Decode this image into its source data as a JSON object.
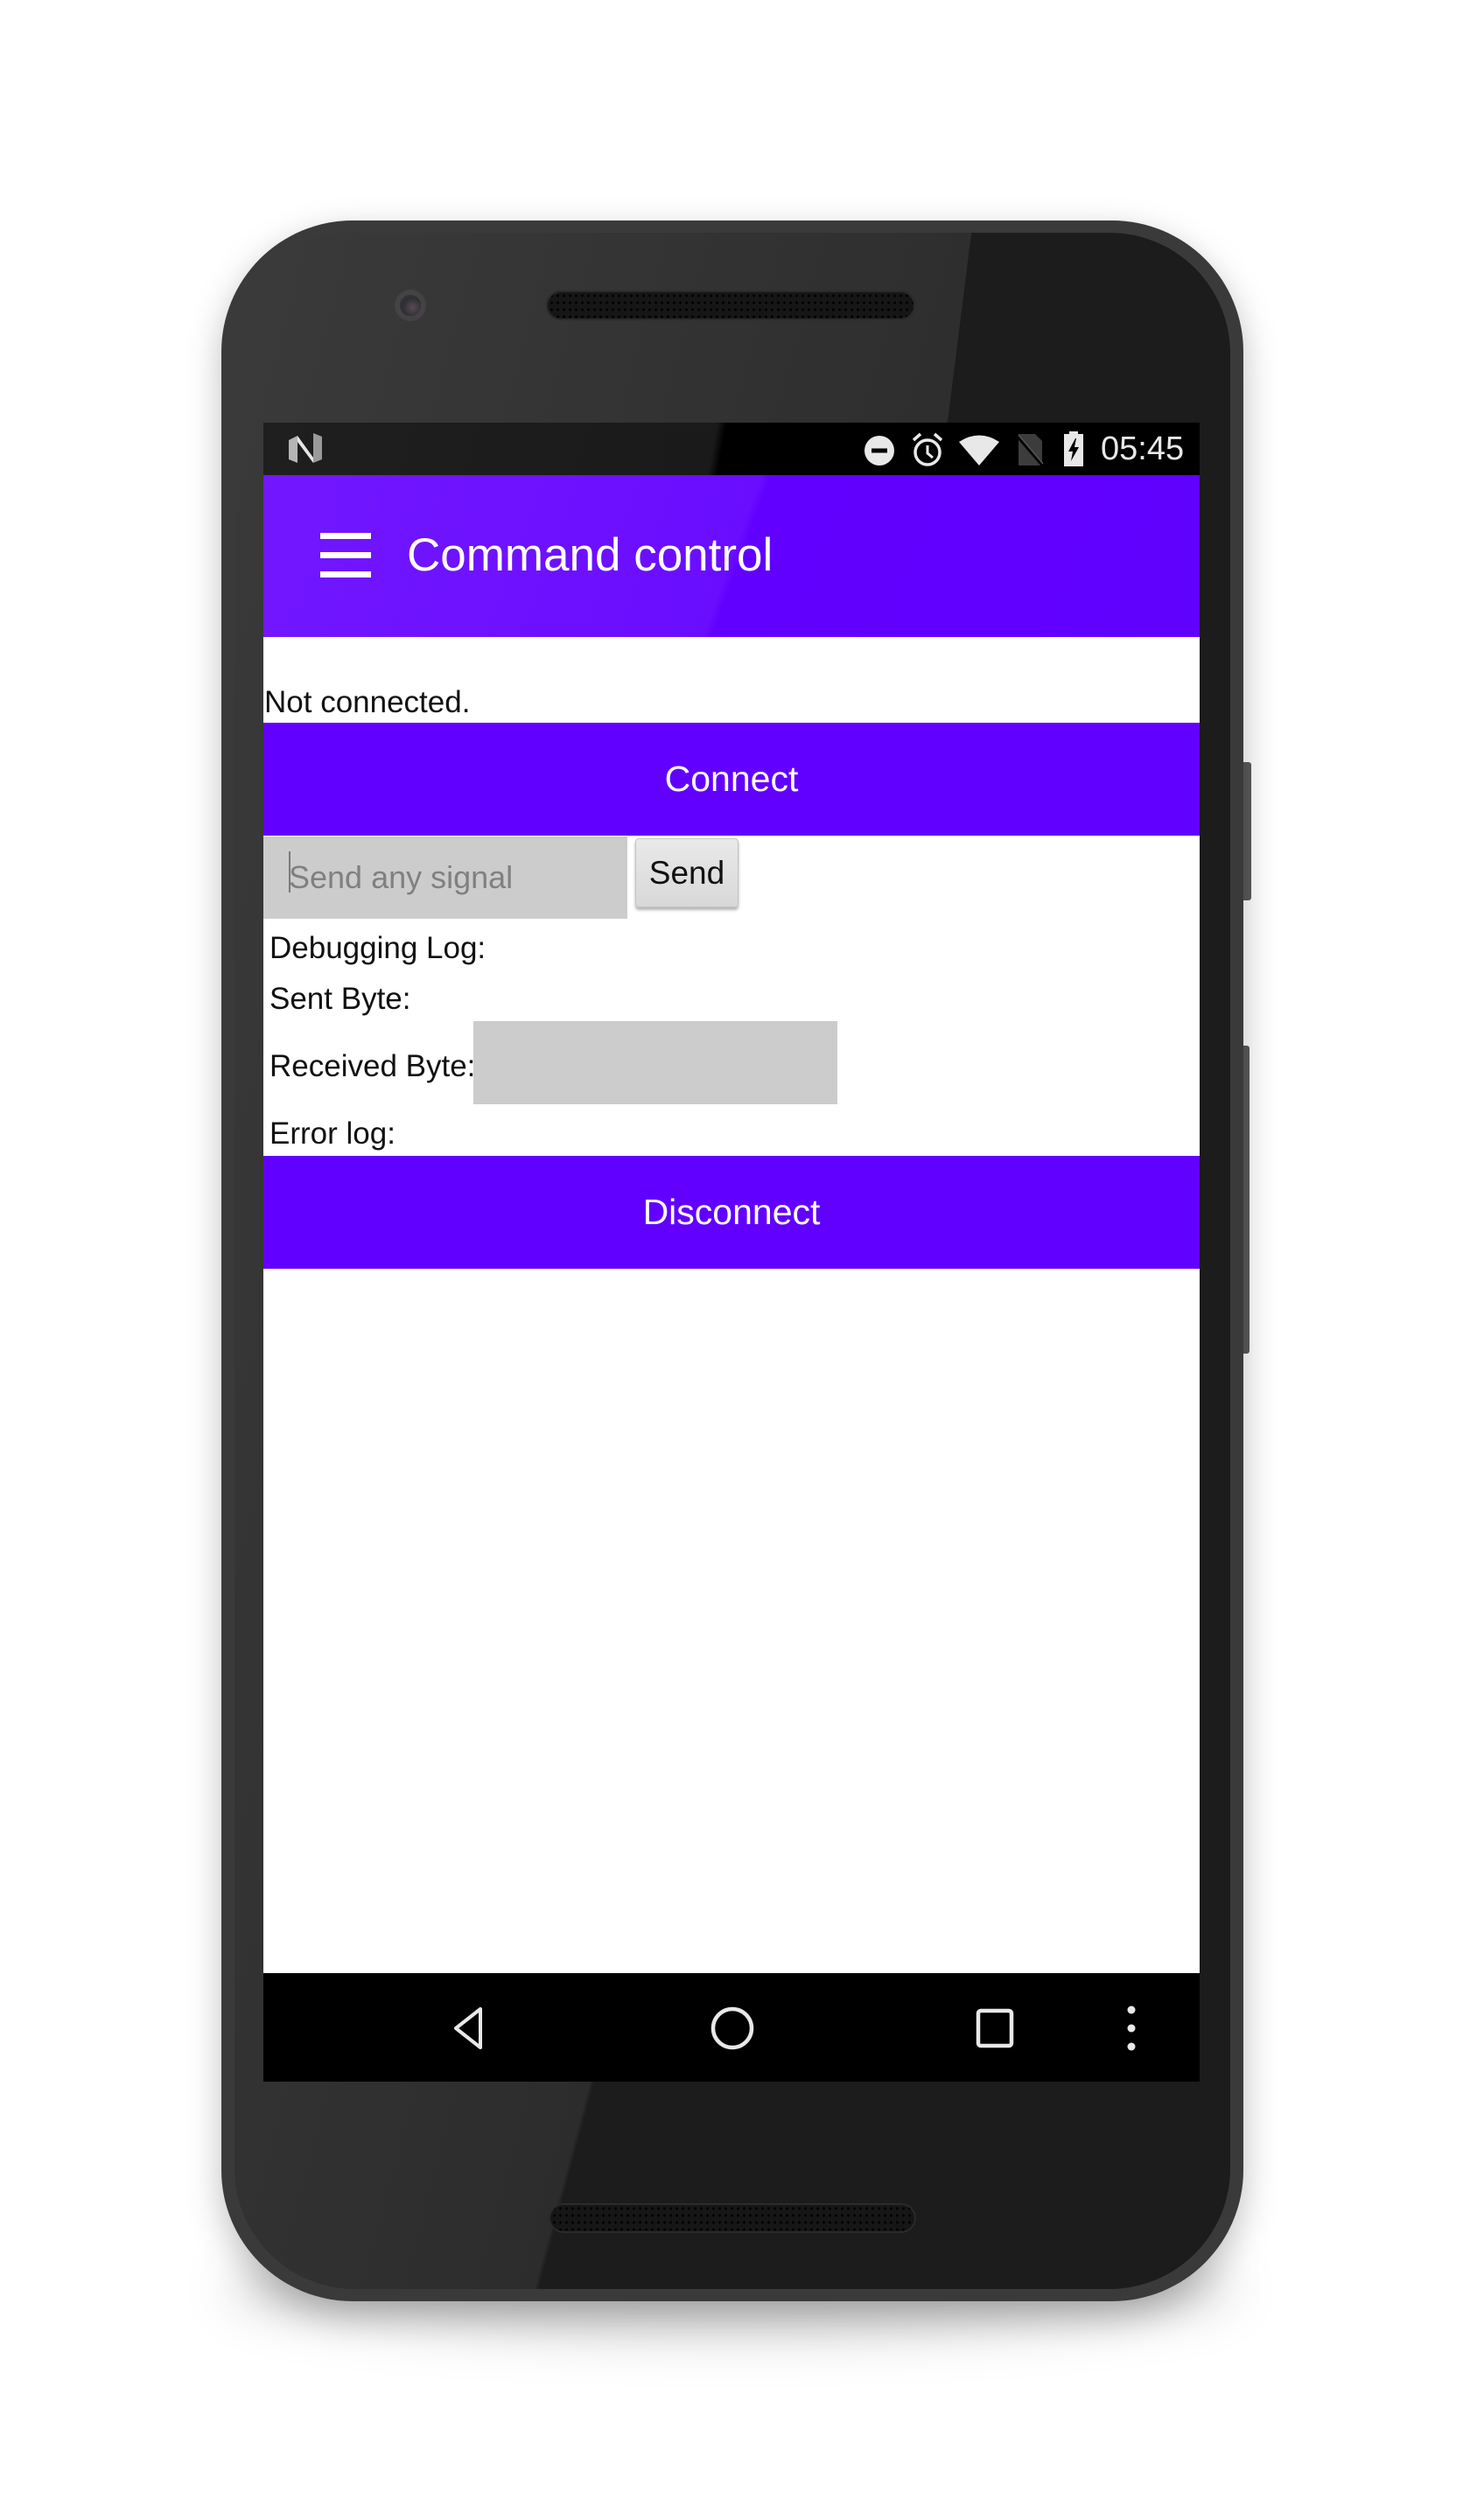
{
  "status_bar": {
    "left_icon": "android-n-logo-icon",
    "icons": [
      "do-not-disturb-icon",
      "alarm-clock-icon",
      "wifi-icon",
      "no-sim-icon",
      "battery-charging-icon"
    ],
    "time": "05:45"
  },
  "app_bar": {
    "menu_icon": "hamburger-menu-icon",
    "title": "Command control"
  },
  "main": {
    "connection_status": "Not connected.",
    "connect_label": "Connect",
    "signal_input": {
      "value": "",
      "placeholder": "Send any signal"
    },
    "send_label": "Send",
    "debug_log_label": "Debugging Log:",
    "sent_byte_label": "Sent Byte:",
    "received_byte_label": "Received Byte:",
    "received_byte_value": "",
    "error_log_label": "Error log:",
    "disconnect_label": "Disconnect"
  },
  "nav_bar": {
    "back": "back-icon",
    "home": "home-icon",
    "recents": "recents-icon",
    "overflow": "overflow-menu-icon"
  },
  "colors": {
    "primary": "#6200ff",
    "input_background": "#cccccc",
    "status_bar": "#000000"
  }
}
